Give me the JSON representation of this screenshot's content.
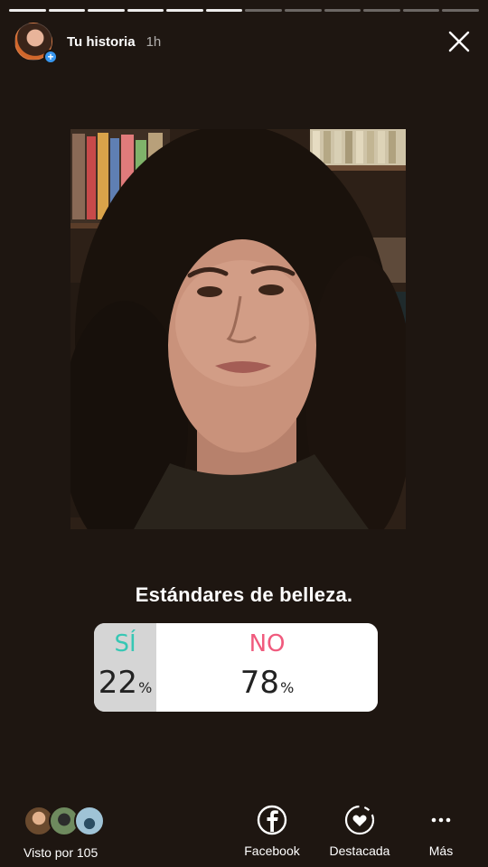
{
  "progress": {
    "total_segments": 12,
    "completed_segments": 6
  },
  "header": {
    "title": "Tu historia",
    "time": "1h",
    "avatar_badge": "+",
    "close_icon": "close-icon"
  },
  "poll": {
    "question": "Estándares de belleza.",
    "options": [
      {
        "label": "SÍ",
        "percent": "22",
        "color": "#37c7b4"
      },
      {
        "label": "NO",
        "percent": "78",
        "color": "#f05a7d"
      }
    ],
    "percent_sign": "%"
  },
  "footer": {
    "seen_by": "Visto por 105",
    "actions": [
      {
        "label": "Facebook",
        "icon": "facebook-icon"
      },
      {
        "label": "Destacada",
        "icon": "highlight-heart-icon"
      },
      {
        "label": "Más",
        "icon": "more-icon"
      }
    ]
  },
  "colors": {
    "background": "#1e1611",
    "yes_bar": "#d5d5d5",
    "accent_blue": "#3897f0"
  }
}
